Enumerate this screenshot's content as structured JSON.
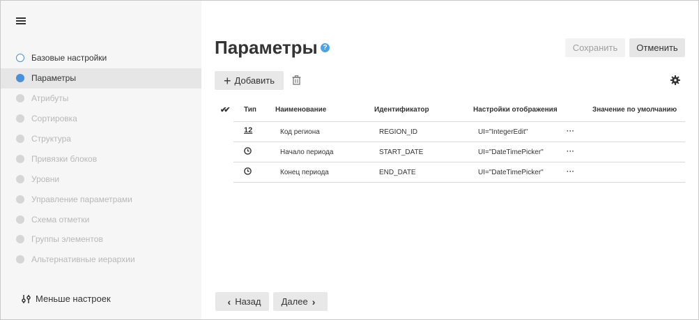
{
  "sidebar": {
    "steps": [
      {
        "label": "Базовые настройки",
        "state": "done"
      },
      {
        "label": "Параметры",
        "state": "active"
      },
      {
        "label": "Атрибуты",
        "state": "disabled"
      },
      {
        "label": "Сортировка",
        "state": "disabled"
      },
      {
        "label": "Структура",
        "state": "disabled"
      },
      {
        "label": "Привязки блоков",
        "state": "disabled"
      },
      {
        "label": "Уровни",
        "state": "disabled"
      },
      {
        "label": "Управление параметрами",
        "state": "disabled"
      },
      {
        "label": "Схема отметки",
        "state": "disabled"
      },
      {
        "label": "Группы элементов",
        "state": "disabled"
      },
      {
        "label": "Альтернативные иерархии",
        "state": "disabled"
      }
    ],
    "less_settings_label": "Меньше настроек"
  },
  "header": {
    "title": "Параметры",
    "help_glyph": "?",
    "save_label": "Сохранить",
    "cancel_label": "Отменить"
  },
  "toolbar": {
    "add_label": "Добавить",
    "add_glyph": "+"
  },
  "table": {
    "columns": {
      "select_all": "✔✔",
      "type": "Тип",
      "name": "Наименование",
      "identifier": "Идентификатор",
      "display": "Настройки отображения",
      "default": "Значение по умолчанию"
    },
    "rows": [
      {
        "type": "number",
        "type_text": "12",
        "name": "Код региона",
        "identifier": "REGION_ID",
        "display": "UI=\"IntegerEdit\"",
        "more": "···"
      },
      {
        "type": "datetime",
        "type_text": "",
        "name": "Начало периода",
        "identifier": "START_DATE",
        "display": "UI=\"DateTimePicker\"",
        "more": "···"
      },
      {
        "type": "datetime",
        "type_text": "",
        "name": "Конец периода",
        "identifier": "END_DATE",
        "display": "UI=\"DateTimePicker\"",
        "more": "···"
      }
    ]
  },
  "footer": {
    "back_label": "Назад",
    "next_label": "Далее"
  },
  "colors": {
    "accent": "#4a90d9",
    "help": "#4aa3e8"
  }
}
